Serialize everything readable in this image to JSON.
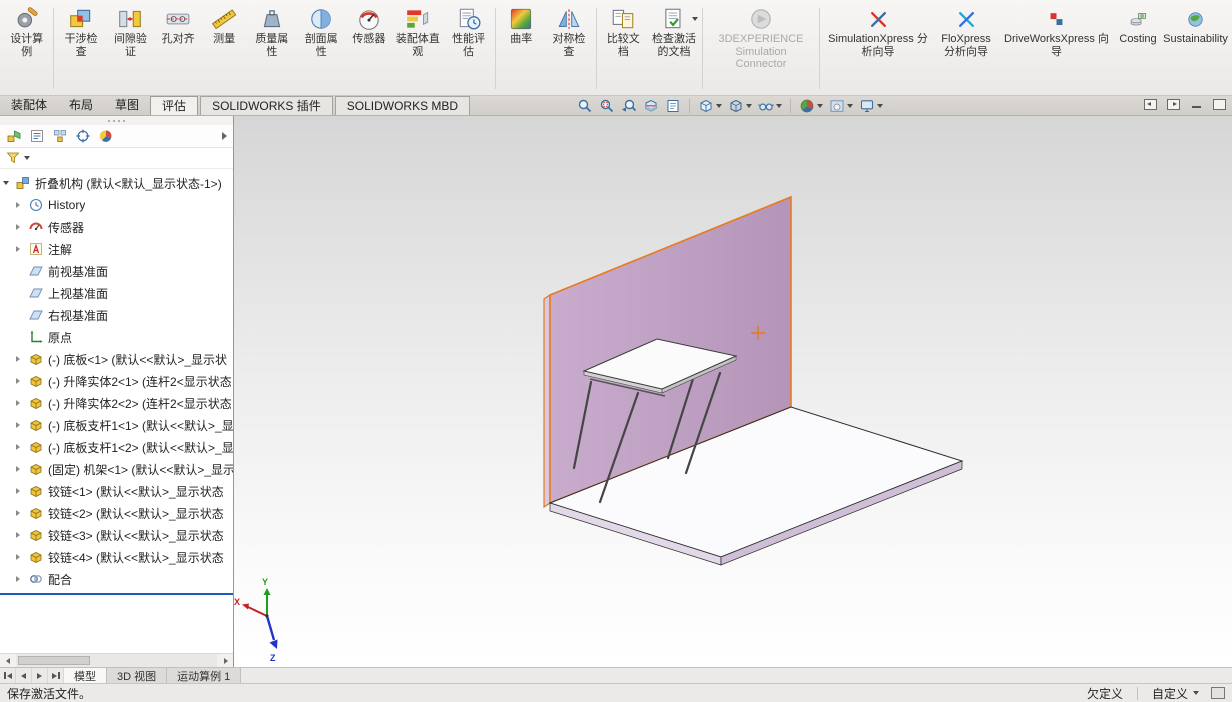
{
  "ribbon": {
    "items": [
      {
        "label": "设计算例",
        "icon": "design-study-icon"
      },
      {
        "label": "干涉检查",
        "icon": "interference-check-icon"
      },
      {
        "label": "间隙验证",
        "icon": "clearance-verification-icon"
      },
      {
        "label": "孔对齐",
        "icon": "hole-alignment-icon"
      },
      {
        "label": "测量",
        "icon": "measure-icon"
      },
      {
        "label": "质量属性",
        "icon": "mass-properties-icon"
      },
      {
        "label": "剖面属性",
        "icon": "section-properties-icon"
      },
      {
        "label": "传感器",
        "icon": "sensor-icon"
      },
      {
        "label": "装配体直观",
        "icon": "assembly-visualization-icon"
      },
      {
        "label": "性能评估",
        "icon": "performance-evaluation-icon"
      },
      {
        "label": "曲率",
        "icon": "curvature-icon"
      },
      {
        "label": "对称检查",
        "icon": "symmetry-check-icon"
      },
      {
        "label": "比较文档",
        "icon": "compare-documents-icon"
      },
      {
        "label": "检查激活的文档",
        "icon": "check-active-document-icon",
        "has_dropdown": true
      },
      {
        "label": "3DEXPERIENCE Simulation Connector",
        "icon": "3dexperience-icon",
        "disabled": true
      },
      {
        "label": "SimulationXpress 分析向导",
        "icon": "simulationxpress-icon"
      },
      {
        "label": "FloXpress 分析向导",
        "icon": "floxpress-icon"
      },
      {
        "label": "DriveWorksXpress 向导",
        "icon": "driveworksxpress-icon"
      },
      {
        "label": "Costing",
        "icon": "costing-icon"
      },
      {
        "label": "Sustainability",
        "icon": "sustainability-icon"
      }
    ]
  },
  "tabbar": {
    "tabs": [
      "装配体",
      "布局",
      "草图",
      "评估",
      "SOLIDWORKS 插件",
      "SOLIDWORKS MBD"
    ],
    "active_tab": "评估"
  },
  "headsup": {
    "icons": [
      "zoom-to-fit",
      "zoom-to-area",
      "previous-view",
      "section-view",
      "dynamic-annotation-views",
      "view-orientation",
      "display-style",
      "hide-show-items",
      "edit-appearance",
      "apply-scene",
      "view-settings"
    ]
  },
  "tree": {
    "items": [
      {
        "icon": "assembly",
        "label": "折叠机构 (默认<默认_显示状态-1>)",
        "expanded": true
      },
      {
        "icon": "history",
        "label": "History",
        "expandable": true
      },
      {
        "icon": "sensors",
        "label": "传感器",
        "expandable": true
      },
      {
        "icon": "annotations",
        "label": "注解",
        "expandable": true
      },
      {
        "icon": "plane",
        "label": "前视基准面"
      },
      {
        "icon": "plane",
        "label": "上视基准面"
      },
      {
        "icon": "plane",
        "label": "右视基准面"
      },
      {
        "icon": "origin",
        "label": "原点"
      },
      {
        "icon": "part",
        "label": "(-) 底板<1> (默认<<默认>_显示状",
        "expandable": true
      },
      {
        "icon": "part",
        "label": "(-) 升降实体2<1> (连杆2<显示状态",
        "expandable": true
      },
      {
        "icon": "part",
        "label": "(-) 升降实体2<2> (连杆2<显示状态",
        "expandable": true
      },
      {
        "icon": "part",
        "label": "(-) 底板支杆1<1> (默认<<默认>_显",
        "expandable": true
      },
      {
        "icon": "part",
        "label": "(-) 底板支杆1<2> (默认<<默认>_显",
        "expandable": true
      },
      {
        "icon": "part",
        "label": "(固定) 机架<1> (默认<<默认>_显示",
        "expandable": true
      },
      {
        "icon": "part",
        "label": "铰链<1> (默认<<默认>_显示状态",
        "expandable": true
      },
      {
        "icon": "part",
        "label": "铰链<2> (默认<<默认>_显示状态",
        "expandable": true
      },
      {
        "icon": "part",
        "label": "铰链<3> (默认<<默认>_显示状态",
        "expandable": true
      },
      {
        "icon": "part",
        "label": "铰链<4> (默认<<默认>_显示状态",
        "expandable": true
      },
      {
        "icon": "mates",
        "label": "配合",
        "expandable": true
      }
    ]
  },
  "doc_tabs": {
    "tabs": [
      "模型",
      "3D 视图",
      "运动算例 1"
    ],
    "active": "模型"
  },
  "statusbar": {
    "message": "保存激活文件。",
    "definition_state": "欠定义",
    "custom_label": "自定义"
  },
  "triad": {
    "x": "X",
    "y": "Y",
    "z": "Z"
  },
  "colors": {
    "selection_orange": "#e87a1e",
    "wall_fill": "#c4a7c8",
    "rollback_blue": "#2059c0"
  }
}
